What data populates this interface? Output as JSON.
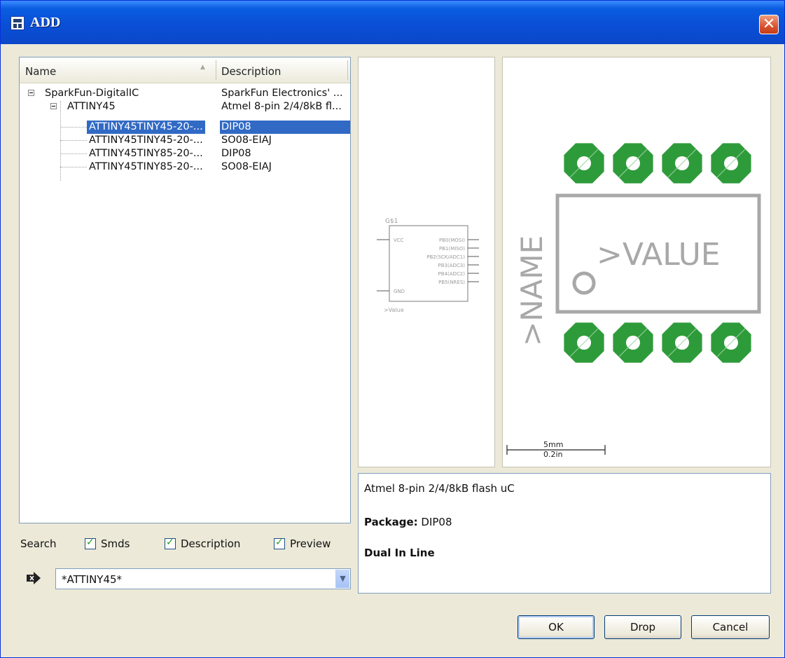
{
  "window": {
    "title": "ADD",
    "close_glyph": "✕"
  },
  "tree": {
    "columns": {
      "name": "Name",
      "description": "Description"
    },
    "rows": [
      {
        "name": "SparkFun-DigitalIC",
        "description": "SparkFun Electronics' ..."
      },
      {
        "name": "ATTINY45",
        "description": "Atmel 8-pin 2/4/8kB fl..."
      },
      {
        "name": "ATTINY45TINY45-20-...",
        "description": "DIP08"
      },
      {
        "name": "ATTINY45TINY45-20-...",
        "description": "SO08-EIAJ"
      },
      {
        "name": "ATTINY45TINY85-20-...",
        "description": "DIP08"
      },
      {
        "name": "ATTINY45TINY85-20-...",
        "description": "SO08-EIAJ"
      }
    ]
  },
  "search": {
    "label": "Search",
    "options": {
      "smds": "Smds",
      "description": "Description",
      "preview": "Preview"
    },
    "value": "*ATTINY45*"
  },
  "symbol": {
    "name": "G$1",
    "pins_left": [
      "VCC",
      "GND"
    ],
    "pins_right": [
      "PB0(MOSI)",
      "PB1(MISO)",
      "PB2(SCK/ADC1)",
      "PB3(ADC3)",
      "PB4(ADC2)",
      "PB5(NRES)"
    ],
    "value": ">Value"
  },
  "package": {
    "name_label": ">NAME",
    "value_label": ">VALUE",
    "scale_mm": "5mm",
    "scale_in": "0.2in",
    "pad_color": "#2e9b3a"
  },
  "info": {
    "line1": "Atmel 8-pin 2/4/8kB flash uC",
    "package_label": "Package:",
    "package_value": "DIP08",
    "line3": "Dual In Line"
  },
  "buttons": {
    "ok": "OK",
    "drop": "Drop",
    "cancel": "Cancel"
  }
}
